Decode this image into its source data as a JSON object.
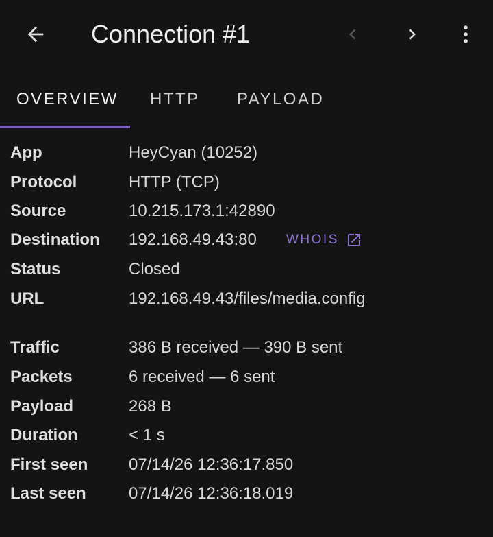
{
  "header": {
    "title": "Connection #1",
    "back_icon": "arrow-left-icon",
    "prev_icon": "chevron-left-icon",
    "next_icon": "chevron-right-icon",
    "more_icon": "more-vertical-icon"
  },
  "tabs": [
    {
      "label": "OVERVIEW",
      "active": true
    },
    {
      "label": "HTTP",
      "active": false
    },
    {
      "label": "PAYLOAD",
      "active": false
    }
  ],
  "details": [
    {
      "label": "App",
      "value": "HeyCyan (10252)"
    },
    {
      "label": "Protocol",
      "value": "HTTP (TCP)"
    },
    {
      "label": "Source",
      "value": "10.215.173.1:42890"
    },
    {
      "label": "Destination",
      "value": "192.168.49.43:80",
      "action": "WHOIS"
    },
    {
      "label": "Status",
      "value": "Closed"
    },
    {
      "label": "URL",
      "value": "192.168.49.43/files/media.config"
    }
  ],
  "stats": [
    {
      "label": "Traffic",
      "value": "386 B received — 390 B sent"
    },
    {
      "label": "Packets",
      "value": "6 received — 6 sent"
    },
    {
      "label": "Payload",
      "value": "268 B"
    },
    {
      "label": "Duration",
      "value": "< 1 s"
    },
    {
      "label": "First seen",
      "value": "07/14/26 12:36:17.850"
    },
    {
      "label": "Last seen",
      "value": "07/14/26 12:36:18.019"
    }
  ],
  "colors": {
    "background": "#141414",
    "accent": "#7b5fb8",
    "link": "#8f74d4"
  }
}
